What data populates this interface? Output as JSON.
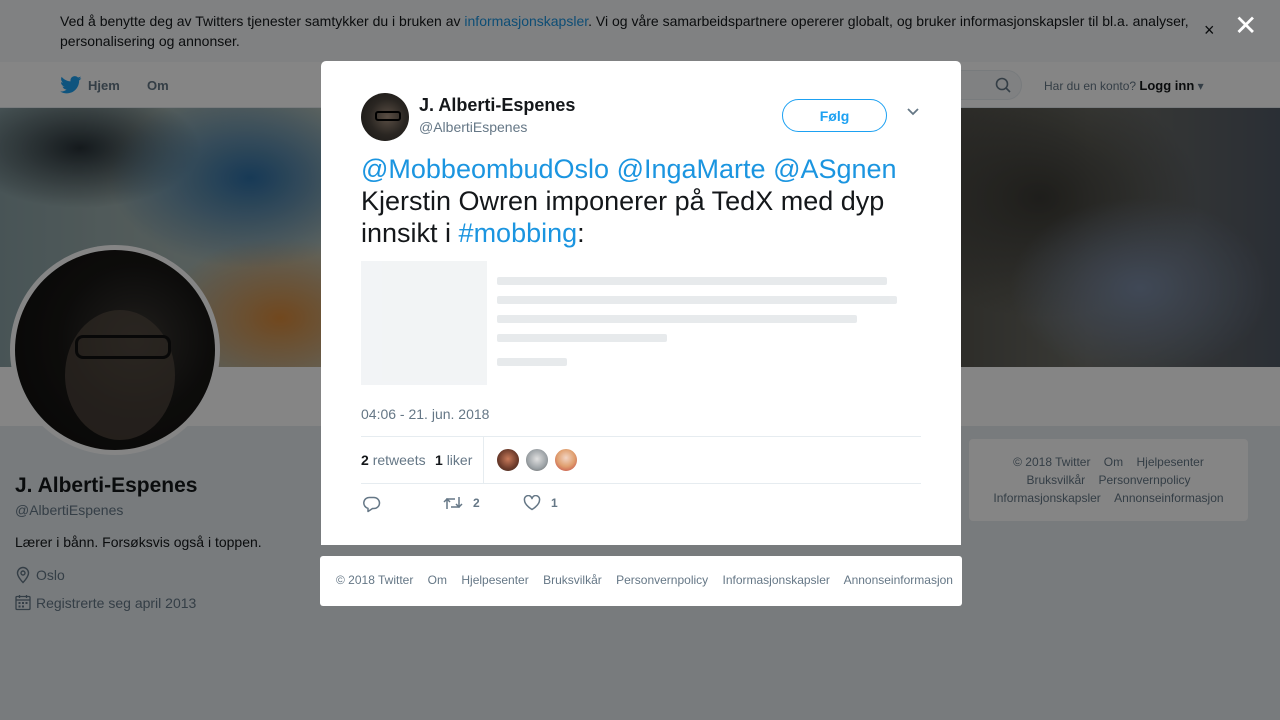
{
  "cookie_banner": {
    "text_before": "Ved å benytte deg av Twitters tjenester samtykker du i bruken av ",
    "link": "informasjonskapsler",
    "text_after": ". Vi og våre samarbeidspartnere opererer globalt, og bruker informasjonskapsler til bl.a. analyser, personalisering og annonser.",
    "close": "×"
  },
  "nav": {
    "home": "Hjem",
    "about": "Om",
    "login_prompt": "Har du en konto?",
    "login": "Logg inn"
  },
  "profile": {
    "name": "J. Alberti-Espenes",
    "handle": "@AlbertiEspenes",
    "bio": "Lærer i bånn. Forsøksvis også i toppen.",
    "location": "Oslo",
    "joined": "Registrerte seg april 2013"
  },
  "side_footer": {
    "links": [
      "© 2018 Twitter",
      "Om",
      "Hjelpesenter",
      "Bruksvilkår",
      "Personvernpolicy",
      "Informasjonskapsler",
      "Annonseinformasjon"
    ]
  },
  "overlay": {
    "close": "✕"
  },
  "tweet": {
    "author_name": "J. Alberti-Espenes",
    "author_handle": "@AlbertiEspenes",
    "follow_label": "Følg",
    "mention_1": "@MobbeombudOslo",
    "mention_2": "@IngaMarte",
    "mention_3": "@ASgnen",
    "text_main": "Kjerstin Owren imponerer på TedX med dyp innsikt i ",
    "hashtag": "#mobbing",
    "text_end": ":",
    "timestamp": "04:06 - 21. jun. 2018",
    "retweets_count": "2",
    "retweets_label": "retweets",
    "likes_count": "1",
    "likes_label": "liker",
    "action_retweet_count": "2",
    "action_like_count": "1"
  },
  "modal_footer": {
    "links": [
      "© 2018 Twitter",
      "Om",
      "Hjelpesenter",
      "Bruksvilkår",
      "Personvernpolicy",
      "Informasjonskapsler",
      "Annonseinformasjon"
    ]
  },
  "colors": {
    "twitter_blue": "#1da1f2",
    "link_blue": "#1b95e0",
    "secondary_text": "#657786"
  }
}
